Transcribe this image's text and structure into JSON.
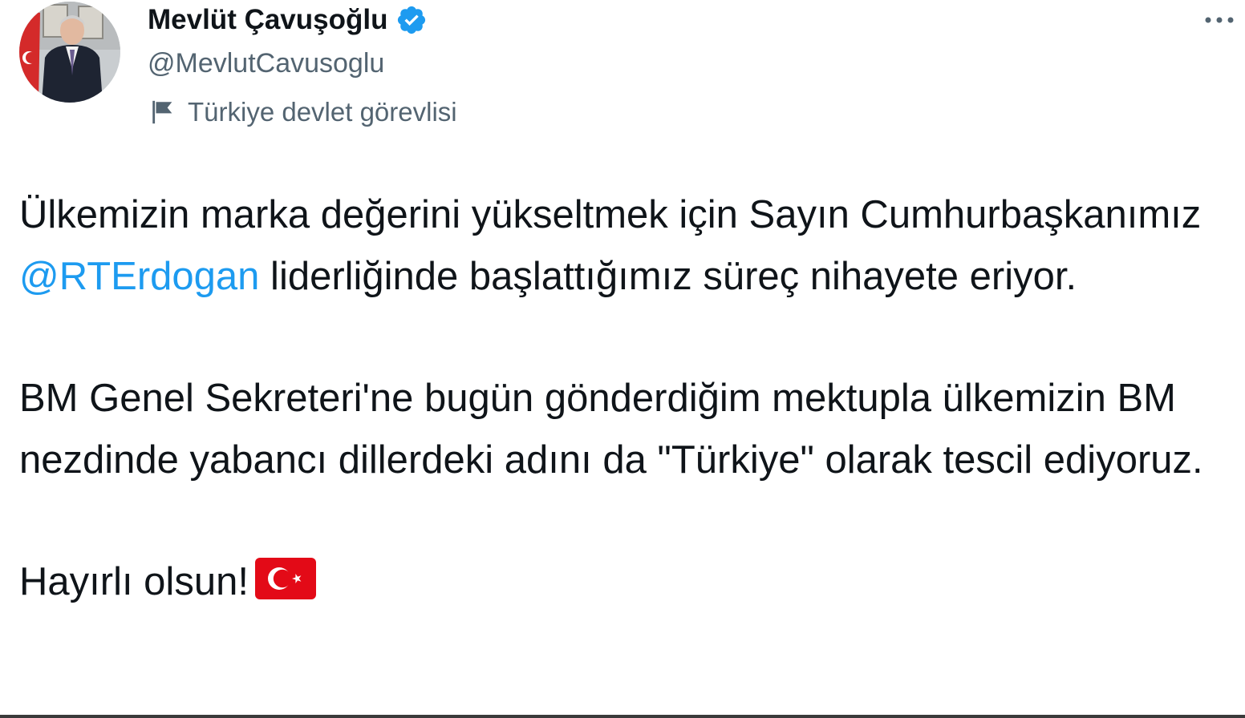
{
  "author": {
    "display_name": "Mevlüt Çavuşoğlu",
    "handle": "@MevlutCavusoglu",
    "label": "Türkiye devlet görevlisi",
    "verified": true,
    "avatar_icon": "profile-photo"
  },
  "menu_icon": "more-horizontal-icon",
  "tweet": {
    "para1_part1": "Ülkemizin marka değerini yükseltmek için Sayın Cumhurbaşkanımız ",
    "mention": "@RTErdogan",
    "para1_part2": " liderliğinde başlattığımız süreç nihayete eriyor.",
    "para2": "BM Genel Sekreteri'ne bugün gönderdiğim mektupla ülkemizin BM nezdinde yabancı dillerdeki adını da \"Türkiye\" olarak tescil ediyoruz.",
    "para3": "Hayırlı olsun!",
    "emoji": "turkey-flag-icon"
  },
  "colors": {
    "text": "#0f1419",
    "secondary": "#536471",
    "link": "#1d9bf0",
    "verified": "#1d9bf0",
    "flag_red": "#e30a17"
  }
}
